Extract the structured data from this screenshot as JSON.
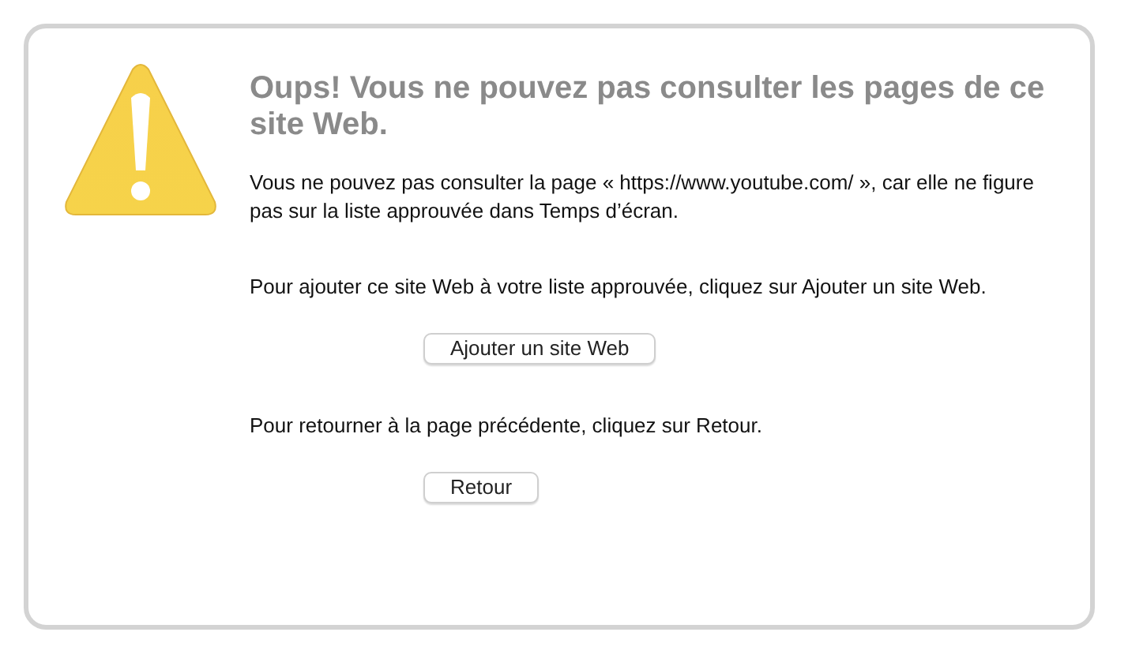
{
  "title": "Oups! Vous ne pouvez pas consulter les pages de ce site Web.",
  "blocks": [
    {
      "kind": "paragraph",
      "text": "Vous ne pouvez pas consulter la page « https://www.youtube.com/ », car elle ne figure pas sur la liste approuvée dans Temps d’écran."
    },
    {
      "kind": "paragraph",
      "text": "Pour ajouter ce site Web à votre liste approuvée, cliquez sur Ajouter un site Web."
    },
    {
      "kind": "button",
      "label": "Ajouter un site Web"
    },
    {
      "kind": "paragraph",
      "text": "Pour retourner à la page précédente, cliquez sur Retour."
    },
    {
      "kind": "button",
      "label": "Retour"
    }
  ]
}
